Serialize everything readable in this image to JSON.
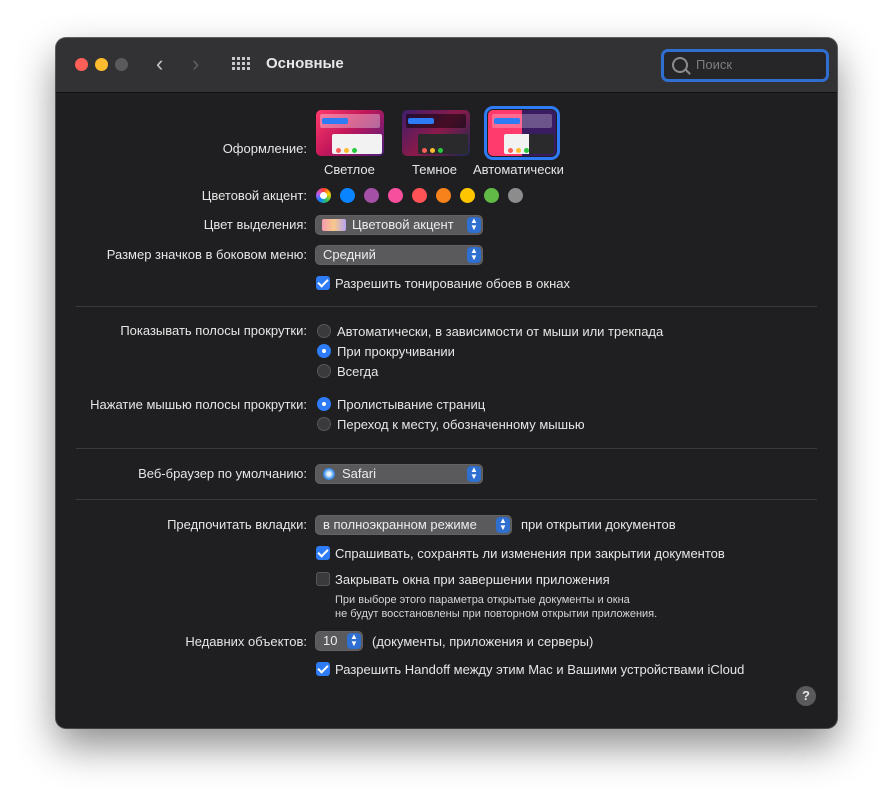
{
  "window": {
    "title": "Основные"
  },
  "search": {
    "placeholder": "Поиск"
  },
  "appearance": {
    "label": "Оформление:",
    "options": [
      {
        "name": "Светлое"
      },
      {
        "name": "Темное"
      },
      {
        "name": "Автоматически",
        "selected": true
      }
    ]
  },
  "accent": {
    "label": "Цветовой акцент:",
    "colors": [
      "multicolor",
      "#0a84ff",
      "#a550a7",
      "#f74f9e",
      "#ff5257",
      "#f7821b",
      "#ffc600",
      "#62ba46",
      "#8c8c8c"
    ]
  },
  "highlight": {
    "label": "Цвет выделения:",
    "value": "Цветовой акцент"
  },
  "sidebar_icon_size": {
    "label": "Размер значков в боковом меню:",
    "value": "Средний"
  },
  "wallpaper_tinting": {
    "label": "Разрешить тонирование обоев в окнах",
    "checked": true
  },
  "show_scrollbars": {
    "label": "Показывать полосы прокрутки:",
    "options": [
      {
        "label": "Автоматически, в зависимости от мыши или трекпада",
        "selected": false
      },
      {
        "label": "При прокручивании",
        "selected": true
      },
      {
        "label": "Всегда",
        "selected": false
      }
    ]
  },
  "scrollbar_click": {
    "label": "Нажатие мышью полосы прокрутки:",
    "options": [
      {
        "label": "Пролистывание страниц",
        "selected": true
      },
      {
        "label": "Переход к месту, обозначенному мышью",
        "selected": false
      }
    ]
  },
  "default_browser": {
    "label": "Веб-браузер по умолчанию:",
    "value": "Safari"
  },
  "prefer_tabs": {
    "label": "Предпочитать вкладки:",
    "value": "в полноэкранном режиме",
    "suffix": "при открытии документов"
  },
  "ask_keep_changes": {
    "label": "Спрашивать, сохранять ли изменения при закрытии документов",
    "checked": true
  },
  "close_windows": {
    "label": "Закрывать окна при завершении приложения",
    "checked": false,
    "note_line1": "При выборе этого параметра открытые документы и окна",
    "note_line2": "не будут восстановлены при повторном открытии приложения."
  },
  "recent_items": {
    "label": "Недавних объектов:",
    "value": "10",
    "suffix": "(документы, приложения и серверы)"
  },
  "handoff": {
    "label": "Разрешить Handoff между этим Mac и Вашими устройствами iCloud",
    "checked": true
  },
  "help": {
    "label": "?"
  }
}
